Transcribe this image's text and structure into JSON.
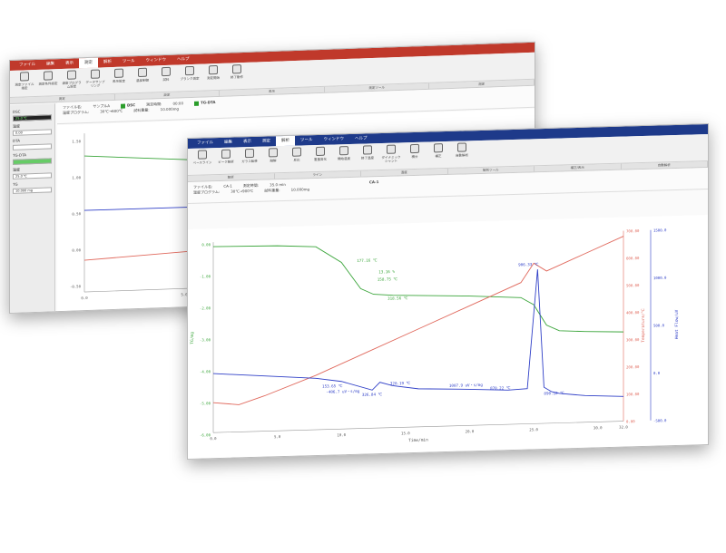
{
  "back_window": {
    "menu": [
      "ファイル",
      "編集",
      "表示",
      "測定",
      "解析",
      "ツール",
      "ウィンドウ",
      "ヘルプ"
    ],
    "active_menu_index": 3,
    "ribbon": [
      {
        "label": "測定ファイル指定",
        "icon": "file-icon"
      },
      {
        "label": "測定条件設定",
        "icon": "settings-icon"
      },
      {
        "label": "温度プログラム設定",
        "icon": "program-icon"
      },
      {
        "label": "データサンプリング",
        "icon": "sampling-icon"
      },
      {
        "label": "表示設定",
        "icon": "display-icon"
      },
      {
        "label": "温度制御",
        "icon": "control-icon"
      },
      {
        "label": "試料",
        "icon": "sample-icon"
      },
      {
        "label": "ブランク測定",
        "icon": "blank-icon"
      },
      {
        "label": "測定開始",
        "icon": "start-icon"
      },
      {
        "label": "終了動作",
        "icon": "stop-icon"
      }
    ],
    "group_strip": [
      "測定",
      "設定",
      "表示",
      "測定ツール",
      "測定"
    ],
    "info_title": "DSC",
    "info_title2": "TG-DTA",
    "info_rows": [
      [
        "ファイル名:",
        "サンプルA",
        "測定時間:",
        "00:00"
      ],
      [
        "温度プログラム:",
        "30℃→600℃",
        "試料重量:",
        "10.000mg"
      ]
    ],
    "side_labels": [
      "DSC",
      "温度",
      "DTA",
      "TG-DTA",
      "温度",
      "TG"
    ],
    "side_values": [
      "25.0 ℃",
      "0.00",
      "",
      "",
      "25.0 ℃",
      "10.000 mg"
    ],
    "y_ticks": [
      "1.50",
      "1.00",
      "0.50",
      "0.00",
      "-0.50"
    ],
    "x_ticks": [
      "0.0",
      "5.0",
      "10.0",
      "15.0",
      "20.0"
    ]
  },
  "front_window": {
    "menu": [
      "ファイル",
      "編集",
      "表示",
      "測定",
      "解析",
      "ツール",
      "ウィンドウ",
      "ヘルプ"
    ],
    "active_menu_index": 4,
    "ribbon": [
      {
        "label": "ベースライン",
        "icon": "baseline-icon"
      },
      {
        "label": "ピーク解析",
        "icon": "peak-icon"
      },
      {
        "label": "ガラス転移",
        "icon": "glass-icon"
      },
      {
        "label": "融解",
        "icon": "melt-icon"
      },
      {
        "label": "反応",
        "icon": "reaction-icon"
      },
      {
        "label": "重量変化",
        "icon": "mass-icon"
      },
      {
        "label": "開始温度",
        "icon": "onset-icon"
      },
      {
        "label": "終了温度",
        "icon": "endset-icon"
      },
      {
        "label": "ダイナミックシャント",
        "icon": "shunt-icon"
      },
      {
        "label": "積分",
        "icon": "integrate-icon"
      },
      {
        "label": "補正",
        "icon": "correct-icon"
      },
      {
        "label": "自動解析",
        "icon": "auto-icon"
      }
    ],
    "group_strip": [
      "解析",
      "ライン",
      "温度",
      "解析ツール",
      "補正/表示",
      "自動解析"
    ],
    "info_title": "CA-1",
    "info_rows": [
      [
        "ファイル名:",
        "CA-1",
        "測定時間:",
        "35.0 min"
      ],
      [
        "温度プログラム:",
        "30℃→900℃",
        "試料重量:",
        "10.000mg"
      ]
    ]
  },
  "chart_data": [
    {
      "type": "line",
      "title": "CA-1",
      "xlabel": "Time/min",
      "ylabels": [
        "TG/mg",
        "Temperature/℃",
        "Heat Flow/uV"
      ],
      "x_ticks": [
        "0.0",
        "5.0",
        "10.0",
        "15.0",
        "20.0",
        "25.0",
        "30.0",
        "32.0"
      ],
      "y_left_ticks": [
        "0.00",
        "-1.00",
        "-2.00",
        "-3.00",
        "-4.00",
        "-5.00",
        "-6.00"
      ],
      "y_right_temp_ticks": [
        "700.00",
        "600.00",
        "500.00",
        "400.00",
        "300.00",
        "200.00",
        "100.00",
        "0.00"
      ],
      "y_right_heat_ticks": [
        "1500.0",
        "1000.0",
        "500.0",
        "0.0",
        "-500.0"
      ],
      "series": [
        {
          "name": "TG",
          "color": "#3aa53a",
          "x": [
            0,
            5,
            8,
            10,
            11.5,
            12.5,
            14,
            20,
            24,
            25,
            26,
            27,
            29,
            32
          ],
          "y": [
            0.05,
            0.02,
            -0.05,
            -0.6,
            -1.5,
            -1.7,
            -1.75,
            -1.85,
            -1.95,
            -2.2,
            -2.9,
            -3.1,
            -3.15,
            -3.2
          ]
        },
        {
          "name": "Temperature",
          "color": "#e0685c",
          "x": [
            0,
            2,
            4,
            8,
            12,
            16,
            20,
            24,
            25,
            26,
            27,
            29,
            32
          ],
          "y": [
            110,
            100,
            130,
            200,
            280,
            360,
            440,
            520,
            590,
            560,
            580,
            620,
            680
          ]
        },
        {
          "name": "Heat Flow",
          "color": "#2f3fc7",
          "x": [
            0,
            4,
            8,
            10,
            12.4,
            13,
            14,
            16,
            20,
            23,
            24.5,
            25.3,
            25.8,
            26.4,
            27,
            29,
            32
          ],
          "y": [
            120,
            80,
            40,
            0,
            -100,
            -20,
            -60,
            -100,
            -120,
            -140,
            -130,
            1120,
            -120,
            -170,
            -190,
            -220,
            -240
          ]
        }
      ],
      "annotations": [
        "177.16 ℃",
        "13.16 %",
        "158.75 ℃",
        "318.56 ℃",
        "906.33 ℃",
        "153.65 ℃",
        "-406.7 uV・s/mg",
        "320.19 ℃",
        "326.84 ℃",
        "1007.9 uV・s/mg",
        "870.22 ℃",
        "890.18 ℃"
      ],
      "grid": false,
      "legend": "none"
    }
  ]
}
